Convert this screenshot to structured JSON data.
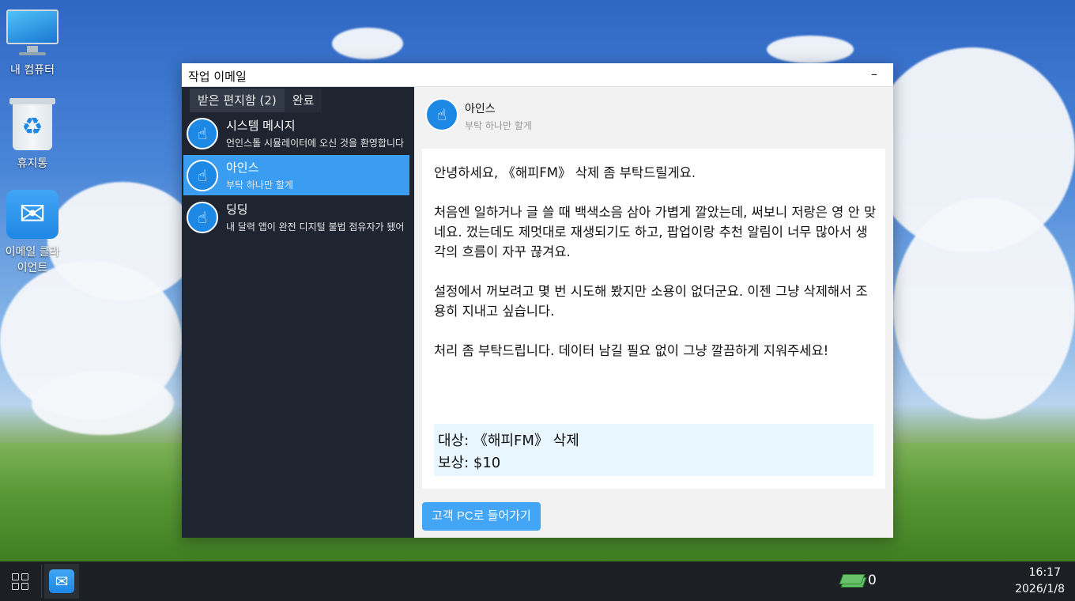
{
  "desktop": {
    "icons": [
      {
        "label": "내 컴퓨터",
        "icon": "computer-icon"
      },
      {
        "label": "휴지통",
        "icon": "recycle-bin-icon"
      },
      {
        "label": "이메일 클라이언트",
        "icon": "mail-icon"
      }
    ]
  },
  "window": {
    "title": "작업 이메일",
    "minimize_label": "–"
  },
  "tabs": [
    {
      "label": "받은 편지함 (2)",
      "active": true
    },
    {
      "label": "완료",
      "active": false
    }
  ],
  "mails": [
    {
      "sender": "시스템 메시지",
      "preview": "언인스톨 시뮬레이터에 오신 것을 환영합니다",
      "icon": "pointing-hand-icon"
    },
    {
      "sender": "아인스",
      "preview": "부탁 하나만 할게",
      "icon": "pointing-hand-icon",
      "selected": true
    },
    {
      "sender": "딩딩",
      "preview": "내 달력 앱이 완전 디지털 불법 점유자가 됐어",
      "icon": "pointing-hand-icon"
    }
  ],
  "message": {
    "sender": "아인스",
    "subject": "부탁 하나만 할게",
    "paragraphs": [
      "안녕하세요, 《해피FM》 삭제 좀 부탁드릴게요.",
      "처음엔 일하거나 글 쓸 때 백색소음 삼아 가볍게 깔았는데, 써보니 저랑은 영 안 맞네요. 껐는데도 제멋대로 재생되기도 하고, 팝업이랑 추천 알림이 너무 많아서 생각의 흐름이 자꾸 끊겨요.",
      "설정에서 꺼보려고 몇 번 시도해 봤지만 소용이 없더군요. 이젠 그냥 삭제해서 조용히 지내고 싶습니다.",
      "처리 좀 부탁드립니다. 데이터 남길 필요 없이 그냥 깔끔하게 지워주세요!"
    ],
    "target_line": "대상: 《해피FM》 삭제",
    "reward_line": "보상: $10",
    "action_button": "고객 PC로 들어가기"
  },
  "taskbar": {
    "money": "0",
    "time": "16:17",
    "date": "2026/1/8"
  },
  "colors": {
    "accent": "#3a9df2",
    "sidebar_bg": "#1f2530",
    "task_box_bg": "#e8f7ff"
  }
}
